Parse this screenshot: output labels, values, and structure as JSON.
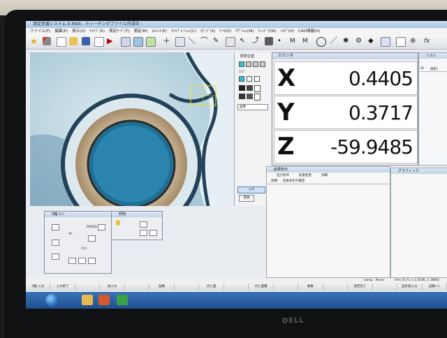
{
  "window": {
    "title": "測定支援システム E-MAX - ティーチングファイル作成中 -"
  },
  "menu": [
    "ファイル(F)",
    "編集(E)",
    "表示(V)",
    "ｷｬﾘﾌﾞ(K)",
    "測定ﾓｰﾄﾞ(T)",
    "測定(M)",
    "ｴﾚﾒﾝﾄ(E)",
    "ｷｬﾘﾌﾞﾚｰｼｮﾝ(C)",
    "ｽﾃｰｼﾞ(S)",
    "ﾂｰﾙ(O)",
    "ｵﾌﾟｼｮﾝ(W)",
    "ｳｨﾝﾄﾞｳ(W)",
    "ﾍﾙﾌﾟ(H)",
    "CAD情報(D)"
  ],
  "control_panel": {
    "title": "照準位置",
    "label2": "ｴｯｼﾞ",
    "select": "画像",
    "button_input": "入力",
    "button_register": "登録"
  },
  "counter": {
    "title": "カウンタ",
    "rows": [
      {
        "axis": "X",
        "value": "0.4405"
      },
      {
        "axis": "Y",
        "value": "0.3717"
      },
      {
        "axis": "Z",
        "value": "-59.9485"
      }
    ]
  },
  "list_panel": {
    "title": "リスト",
    "col1": "ID",
    "col2": "測定ｺ"
  },
  "result_panel": {
    "title": "結果表示",
    "tab1": "出力条件",
    "tab2": "結果変更",
    "tab3": "詳細",
    "sub1": "詳細",
    "sub2": "結果表示の確定"
  },
  "graphic_panel": {
    "title": "グラフィック"
  },
  "z_panel": {
    "title": "Z軸 ﾓｰﾄﾞ",
    "labels": [
      "AF",
      "SPEED",
      "ﾘｾｯﾄ"
    ]
  },
  "light_panel": {
    "title": "照明"
  },
  "status": {
    "left": "Lamp : None",
    "right": "mm (X,Y)=( 2.5036, 2.3806)"
  },
  "function_keys": [
    "Z軸 入力",
    "入力終了",
    "",
    "再入力",
    "",
    "画像",
    "",
    "点と面",
    "",
    "点と面積",
    "",
    "要素",
    "",
    "測定完了",
    "",
    "設計値入力",
    "自動ｼｰﾙ"
  ],
  "brand": "DELL"
}
